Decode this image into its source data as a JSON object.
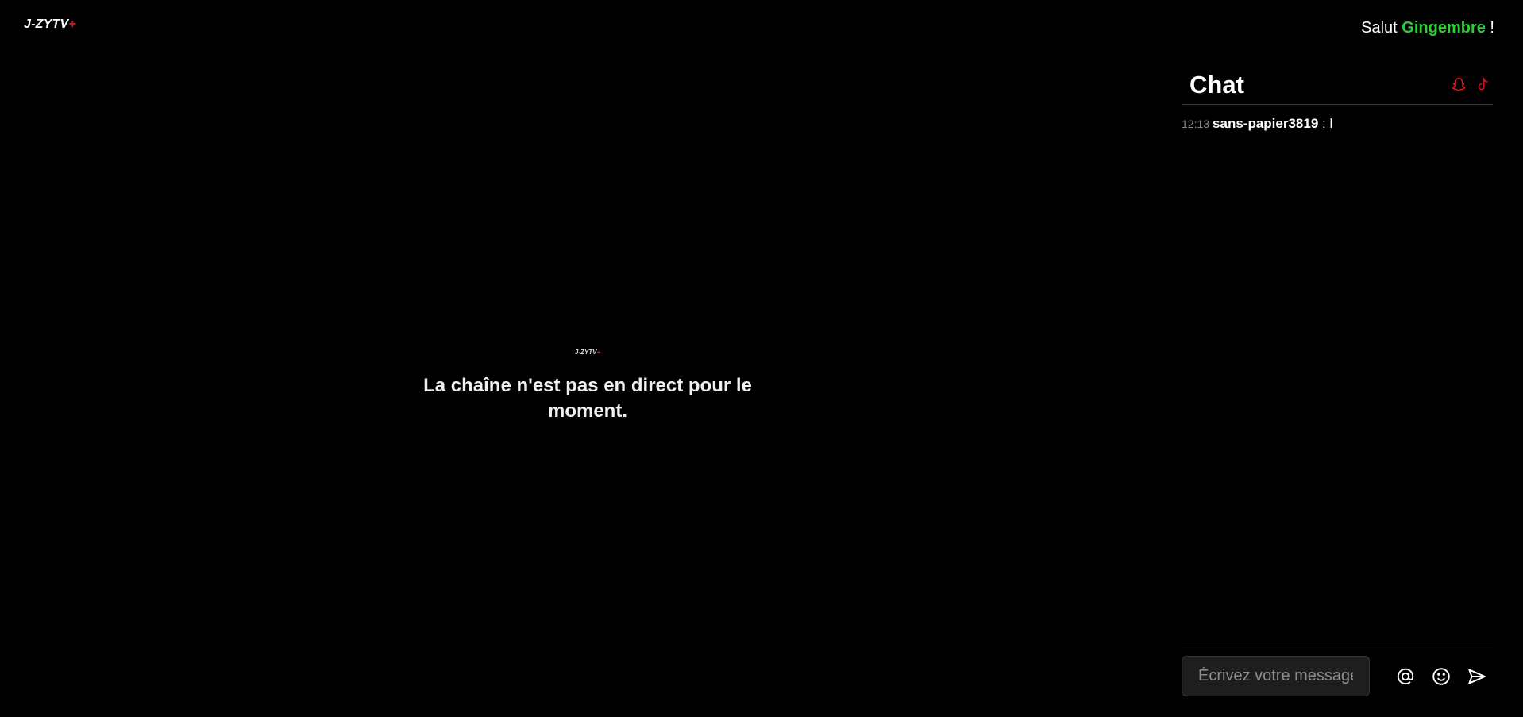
{
  "header": {
    "logo_text": "J-ZYTV",
    "logo_plus": "+",
    "greeting_prefix": "Salut ",
    "username": "Gingembre",
    "greeting_suffix": " !"
  },
  "player": {
    "logo_text": "J-ZYTV",
    "logo_plus": "+",
    "offline_message": "La chaîne n'est pas en direct pour le moment."
  },
  "chat": {
    "title": "Chat",
    "social_icons": [
      "snapchat-icon",
      "tiktok-icon"
    ],
    "messages": [
      {
        "time": "12:13",
        "author": "sans-papier3819",
        "separator": " : ",
        "text": "l"
      }
    ],
    "input_placeholder": "Écrivez votre message",
    "actions": [
      "mention-icon",
      "emoji-icon",
      "send-icon"
    ]
  },
  "colors": {
    "background": "#000000",
    "accent_red": "#e0141e",
    "username_green": "#2fcf3a"
  }
}
